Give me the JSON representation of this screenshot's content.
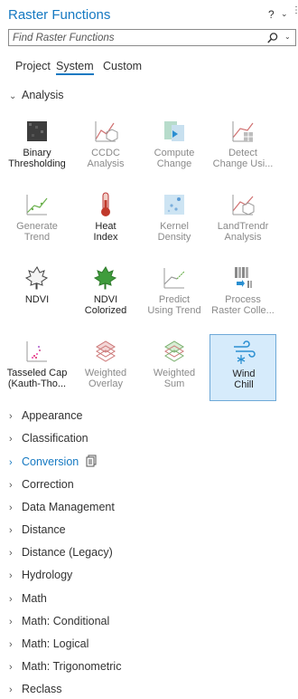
{
  "panel": {
    "title": "Raster Functions",
    "help": "?"
  },
  "search": {
    "placeholder": "Find Raster Functions"
  },
  "tabs": [
    {
      "label": "Project"
    },
    {
      "label": "System"
    },
    {
      "label": "Custom"
    }
  ],
  "group": {
    "label": "Analysis"
  },
  "functions": [
    {
      "label": "Binary\nThresholding",
      "icon": "binary-thresholding-icon",
      "dim": false
    },
    {
      "label": "CCDC\nAnalysis",
      "icon": "ccdc-analysis-icon",
      "dim": true
    },
    {
      "label": "Compute\nChange",
      "icon": "compute-change-icon",
      "dim": true
    },
    {
      "label": "Detect\nChange Usi...",
      "icon": "detect-change-icon",
      "dim": true
    },
    {
      "label": "Generate\nTrend",
      "icon": "generate-trend-icon",
      "dim": true
    },
    {
      "label": "Heat\nIndex",
      "icon": "thermometer-icon",
      "dim": false
    },
    {
      "label": "Kernel\nDensity",
      "icon": "kernel-density-icon",
      "dim": true
    },
    {
      "label": "LandTrendr\nAnalysis",
      "icon": "landtrendr-icon",
      "dim": true
    },
    {
      "label": "NDVI",
      "icon": "maple-leaf-gray-icon",
      "dim": false
    },
    {
      "label": "NDVI\nColorized",
      "icon": "maple-leaf-green-icon",
      "dim": false
    },
    {
      "label": "Predict\nUsing Trend",
      "icon": "predict-trend-icon",
      "dim": true
    },
    {
      "label": "Process\nRaster Colle...",
      "icon": "process-raster-collection-icon",
      "dim": true
    },
    {
      "label": "Tasseled Cap\n(Kauth-Tho...",
      "icon": "tasseled-cap-icon",
      "dim": false
    },
    {
      "label": "Weighted\nOverlay",
      "icon": "weighted-overlay-icon",
      "dim": true
    },
    {
      "label": "Weighted\nSum",
      "icon": "weighted-sum-icon",
      "dim": true
    },
    {
      "label": "Wind\nChill",
      "icon": "wind-chill-icon",
      "dim": false,
      "selected": true
    }
  ],
  "categories": [
    {
      "label": "Appearance"
    },
    {
      "label": "Classification"
    },
    {
      "label": "Conversion",
      "highlight": true
    },
    {
      "label": "Correction"
    },
    {
      "label": "Data Management"
    },
    {
      "label": "Distance"
    },
    {
      "label": "Distance (Legacy)"
    },
    {
      "label": "Hydrology"
    },
    {
      "label": "Math"
    },
    {
      "label": "Math: Conditional"
    },
    {
      "label": "Math: Logical"
    },
    {
      "label": "Math: Trigonometric"
    },
    {
      "label": "Reclass"
    }
  ],
  "colors": {
    "accent": "#1679c2",
    "selected_bg": "#d6ebfb",
    "selected_border": "#6ea9d8",
    "dim_text": "#8a8a8a"
  }
}
